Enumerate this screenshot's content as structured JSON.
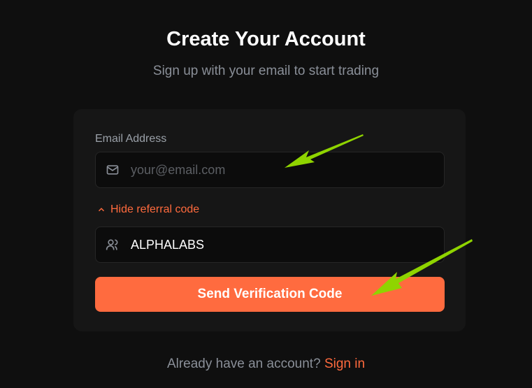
{
  "header": {
    "title": "Create Your Account",
    "subtitle": "Sign up with your email to start trading"
  },
  "form": {
    "email_label": "Email Address",
    "email_placeholder": "your@email.com",
    "email_value": "",
    "referral_toggle": "Hide referral code",
    "referral_value": "ALPHALABS",
    "submit_label": "Send Verification Code"
  },
  "footer": {
    "prompt": "Already have an account?",
    "link": "Sign in"
  },
  "colors": {
    "accent": "#ff6b3f",
    "annotation": "#8fd400"
  }
}
